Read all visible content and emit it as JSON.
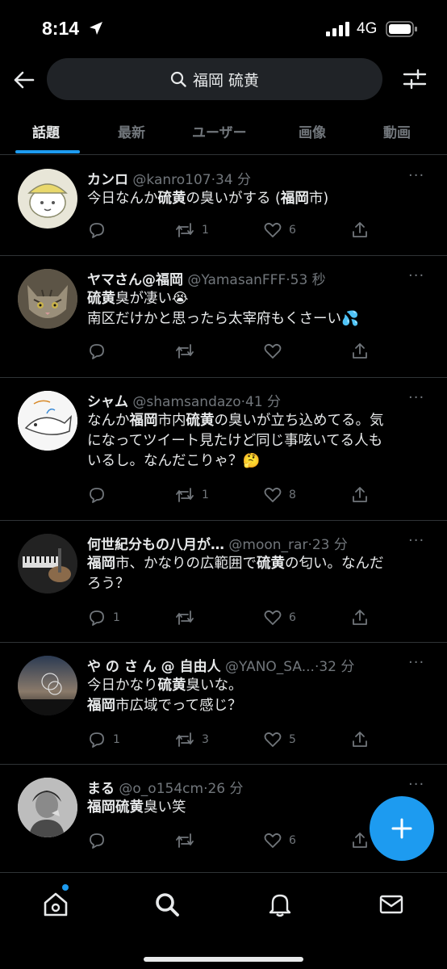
{
  "status_bar": {
    "time": "8:14",
    "network": "4G"
  },
  "search": {
    "query": "福岡 硫黄"
  },
  "tabs": [
    {
      "label": "話題",
      "active": true
    },
    {
      "label": "最新"
    },
    {
      "label": "ユーザー"
    },
    {
      "label": "画像"
    },
    {
      "label": "動画"
    }
  ],
  "tweets": [
    {
      "name": "カンロ",
      "handle": "@kanro107",
      "sep": "·",
      "time": "34 分",
      "lines": [
        [
          {
            "t": "今日なんか"
          },
          {
            "t": "硫黄",
            "b": true
          },
          {
            "t": "の臭いがする ("
          },
          {
            "t": "福岡",
            "b": true
          },
          {
            "t": "市)"
          }
        ]
      ],
      "replies": "",
      "retweets": "1",
      "likes": "6"
    },
    {
      "name": "ヤマさん@福岡",
      "handle": "@YamasanFFF",
      "sep": "·",
      "time": "53 秒",
      "lines": [
        [
          {
            "t": "硫黄",
            "b": true
          },
          {
            "t": "臭が凄い😭"
          }
        ],
        [
          {
            "t": "南区だけかと思ったら太宰府もくさーい💦"
          }
        ]
      ],
      "replies": "",
      "retweets": "",
      "likes": ""
    },
    {
      "name": "シャム",
      "handle": "@shamsandazo",
      "sep": "·",
      "time": "41 分",
      "lines": [
        [
          {
            "t": "なんか"
          },
          {
            "t": "福岡",
            "b": true
          },
          {
            "t": "市内"
          },
          {
            "t": "硫黄",
            "b": true
          },
          {
            "t": "の臭いが立ち込めてる。気"
          }
        ],
        [
          {
            "t": "になってツイート見たけど同じ事呟いてる人も"
          }
        ],
        [
          {
            "t": "いるし。なんだこりゃ？🤔"
          }
        ]
      ],
      "replies": "",
      "retweets": "1",
      "likes": "8"
    },
    {
      "name": "何世紀分もの八月が…",
      "handle": "@moon_rar",
      "sep": "·",
      "time": "23 分",
      "lines": [
        [
          {
            "t": "福岡",
            "b": true
          },
          {
            "t": "市、かなりの広範囲で"
          },
          {
            "t": "硫黄",
            "b": true
          },
          {
            "t": "の匂い。なんだ"
          }
        ],
        [
          {
            "t": "ろう？"
          }
        ]
      ],
      "replies": "1",
      "retweets": "",
      "likes": "6"
    },
    {
      "name": "や の さ ん @ 自由人",
      "handle": "@YANO_SA...",
      "sep": "·",
      "time": "32 分",
      "lines": [
        [
          {
            "t": "今日かなり"
          },
          {
            "t": "硫黄",
            "b": true
          },
          {
            "t": "臭いな。"
          }
        ],
        [
          {
            "t": "福岡",
            "b": true
          },
          {
            "t": "市広域でって感じ？"
          }
        ]
      ],
      "replies": "1",
      "retweets": "3",
      "likes": "5"
    },
    {
      "name": "まる",
      "handle": "@o_o154cm",
      "sep": "·",
      "time": "26 分",
      "lines": [
        [
          {
            "t": "福岡硫黄",
            "b": true
          },
          {
            "t": "臭い笑"
          }
        ]
      ],
      "replies": "",
      "retweets": "",
      "likes": "6"
    }
  ],
  "more_label": "···",
  "colors": {
    "accent": "#1d9bf0",
    "background": "#000000",
    "muted": "#71767b",
    "text": "#e7e9ea"
  },
  "icons": [
    "back-arrow-icon",
    "search-icon",
    "filter-icon",
    "reply-icon",
    "retweet-icon",
    "like-icon",
    "share-icon",
    "compose-plus-icon",
    "home-icon",
    "explore-icon",
    "notifications-icon",
    "messages-icon"
  ]
}
